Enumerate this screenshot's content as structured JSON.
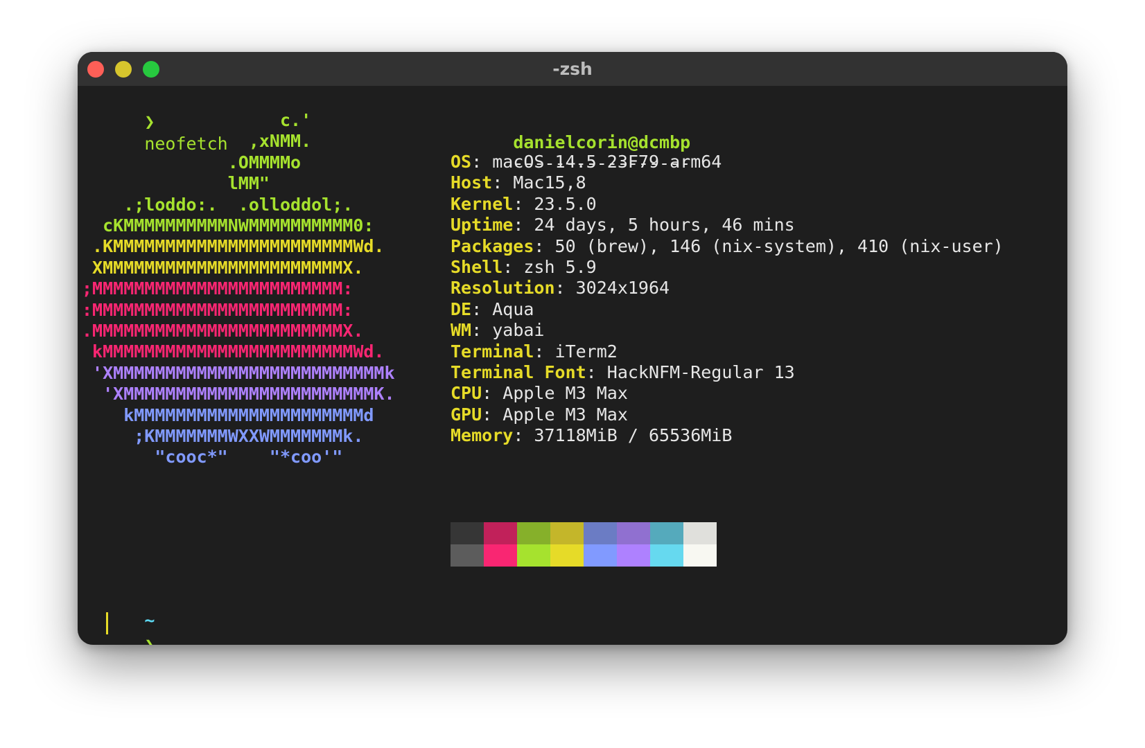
{
  "window": {
    "title": "-zsh"
  },
  "terminal": {
    "prompt_symbol": "❯",
    "command": "neofetch",
    "cwd": "~",
    "cursor_prompt_symbol": "❯"
  },
  "ascii_art": [
    {
      "text": "                   c.'",
      "color": "#a6e22e"
    },
    {
      "text": "                ,xNMM.",
      "color": "#a6e22e"
    },
    {
      "text": "              .OMMMMo",
      "color": "#a6e22e"
    },
    {
      "text": "              lMM\"",
      "color": "#a6e22e"
    },
    {
      "text": "    .;loddo:.  .olloddol;.",
      "color": "#a6e22e"
    },
    {
      "text": "  cKMMMMMMMMMMNWMMMMMMMMMM0:",
      "color": "#a6e22e"
    },
    {
      "text": " .KMMMMMMMMMMMMMMMMMMMMMMMWd.",
      "color": "#e6db28"
    },
    {
      "text": " XMMMMMMMMMMMMMMMMMMMMMMMX.",
      "color": "#e6db28"
    },
    {
      "text": ";MMMMMMMMMMMMMMMMMMMMMMMM:",
      "color": "#f92672"
    },
    {
      "text": ":MMMMMMMMMMMMMMMMMMMMMMMM:",
      "color": "#f92672"
    },
    {
      "text": ".MMMMMMMMMMMMMMMMMMMMMMMMX.",
      "color": "#f92672"
    },
    {
      "text": " kMMMMMMMMMMMMMMMMMMMMMMMMWd.",
      "color": "#f92672"
    },
    {
      "text": " 'XMMMMMMMMMMMMMMMMMMMMMMMMMMk",
      "color": "#ae81ff"
    },
    {
      "text": "  'XMMMMMMMMMMMMMMMMMMMMMMMMK.",
      "color": "#ae81ff"
    },
    {
      "text": "    kMMMMMMMMMMMMMMMMMMMMMMd",
      "color": "#819aff"
    },
    {
      "text": "     ;KMMMMMMMWXXWMMMMMMMk.",
      "color": "#819aff"
    },
    {
      "text": "       \"cooc*\"    \"*coo'\"",
      "color": "#819aff"
    }
  ],
  "info": {
    "userhost": "danielcorin@dcmbp",
    "dashes": "-----------------",
    "fields": [
      {
        "key": "OS",
        "value": "macOS 14.5 23F79 arm64"
      },
      {
        "key": "Host",
        "value": "Mac15,8"
      },
      {
        "key": "Kernel",
        "value": "23.5.0"
      },
      {
        "key": "Uptime",
        "value": "24 days, 5 hours, 46 mins"
      },
      {
        "key": "Packages",
        "value": "50 (brew), 146 (nix-system), 410 (nix-user)"
      },
      {
        "key": "Shell",
        "value": "zsh 5.9"
      },
      {
        "key": "Resolution",
        "value": "3024x1964"
      },
      {
        "key": "DE",
        "value": "Aqua"
      },
      {
        "key": "WM",
        "value": "yabai"
      },
      {
        "key": "Terminal",
        "value": "iTerm2"
      },
      {
        "key": "Terminal Font",
        "value": "HackNFM-Regular 13"
      },
      {
        "key": "CPU",
        "value": "Apple M3 Max"
      },
      {
        "key": "GPU",
        "value": "Apple M3 Max"
      },
      {
        "key": "Memory",
        "value": "37118MiB / 65536MiB"
      }
    ],
    "palette_normal": [
      "#363636",
      "#c1215a",
      "#86b02a",
      "#c4b62a",
      "#6b7cc4",
      "#9070d0",
      "#55aabc",
      "#e0e0dc"
    ],
    "palette_bright": [
      "#5c5c5c",
      "#f92672",
      "#a6e22e",
      "#e6db28",
      "#819aff",
      "#ae81ff",
      "#66d9ef",
      "#f8f8f2"
    ]
  },
  "colors": {
    "window_bg": "#1e1e1e",
    "titlebar_bg": "#323232",
    "accent_green": "#a6e22e",
    "accent_yellow": "#e6db28",
    "tilde_cyan": "#5cd6f0"
  }
}
